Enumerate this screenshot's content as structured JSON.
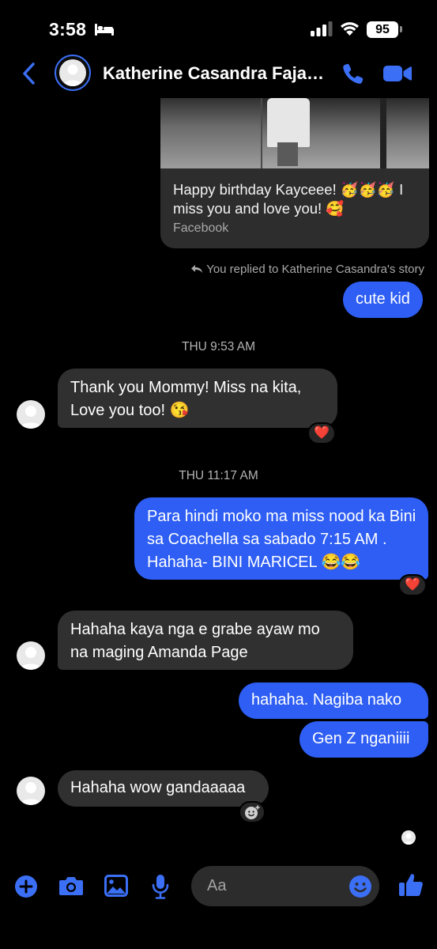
{
  "status_bar": {
    "time": "3:58",
    "battery": "95"
  },
  "header": {
    "contact_name": "Katherine Casandra Fajardo"
  },
  "shared_story": {
    "caption": "Happy birthday Kayceee! 🥳🥳🥳 I miss you and love you! 🥰",
    "source": "Facebook"
  },
  "reply_note": "You replied to Katherine Casandra's story",
  "messages": [
    {
      "direction": "out",
      "text": "cute kid"
    },
    {
      "type": "timestamp",
      "text": "THU 9:53 AM"
    },
    {
      "direction": "in",
      "text": "Thank you Mommy! Miss na kita, Love you too! 😘",
      "reaction": "❤️"
    },
    {
      "type": "timestamp",
      "text": "THU 11:17 AM"
    },
    {
      "direction": "out",
      "text": "Para hindi moko ma miss nood ka Bini sa Coachella sa sabado 7:15 AM . Hahaha- BINI MARICEL 😂😂",
      "reaction": "❤️"
    },
    {
      "direction": "in",
      "text": "Hahaha kaya nga e grabe ayaw mo na maging Amanda Page"
    },
    {
      "direction": "out",
      "text": "hahaha. Nagiba nako"
    },
    {
      "direction": "out",
      "text": "Gen Z nganiiii"
    },
    {
      "direction": "in",
      "text": "Hahaha wow gandaaaaa"
    }
  ],
  "composer": {
    "placeholder": "Aa"
  },
  "icons": {
    "back": "chevron-left-icon",
    "call": "phone-icon",
    "video": "video-camera-icon",
    "plus": "plus-circle-icon",
    "camera": "camera-icon",
    "gallery": "image-icon",
    "mic": "microphone-icon",
    "emoji": "smiley-icon",
    "like": "thumbs-up-icon"
  },
  "colors": {
    "accent": "#2e5ef4",
    "incoming_bubble": "#303030",
    "background": "#000000"
  }
}
